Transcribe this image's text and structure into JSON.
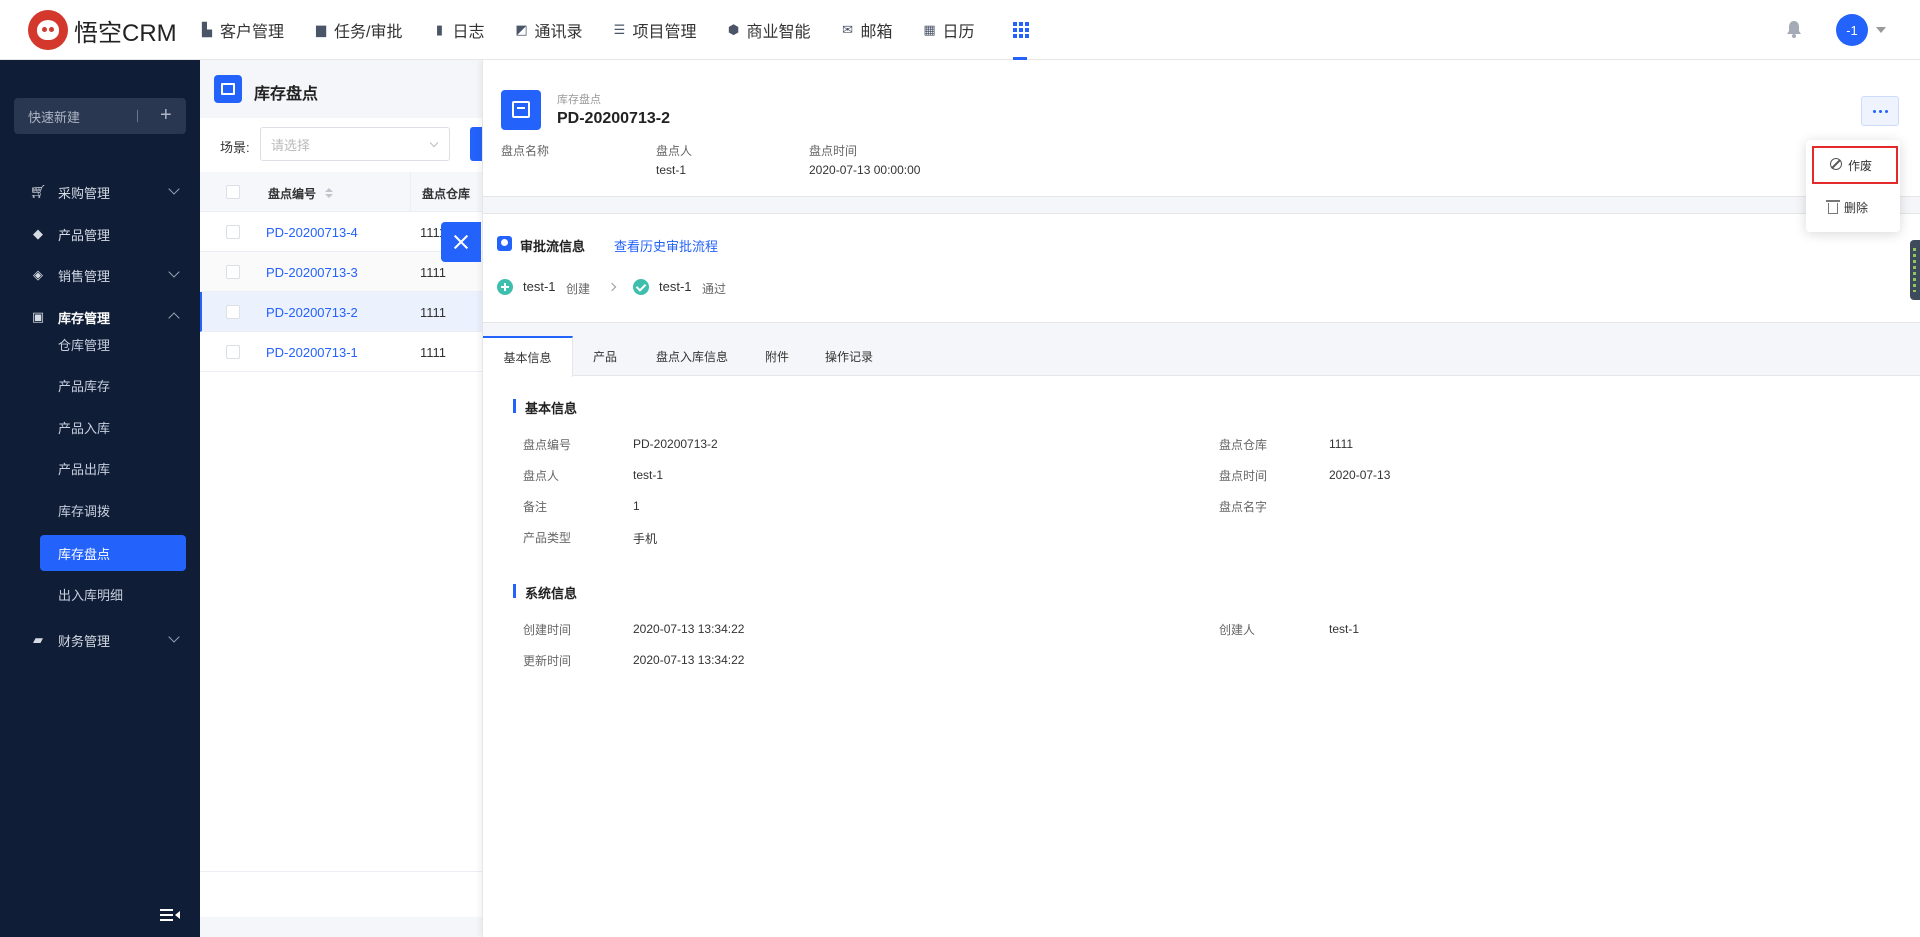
{
  "app": {
    "logo_text": "悟空CRM"
  },
  "nav": {
    "items": [
      {
        "label": "客户管理",
        "icon": "building-icon"
      },
      {
        "label": "任务/审批",
        "icon": "briefcase-icon"
      },
      {
        "label": "日志",
        "icon": "journal-icon"
      },
      {
        "label": "通讯录",
        "icon": "phone-book-icon"
      },
      {
        "label": "项目管理",
        "icon": "project-icon"
      },
      {
        "label": "商业智能",
        "icon": "bi-icon"
      },
      {
        "label": "邮箱",
        "icon": "mail-icon"
      },
      {
        "label": "日历",
        "icon": "calendar-icon"
      }
    ],
    "apps_icon": "grid-icon",
    "avatar_text": "-1"
  },
  "sidebar": {
    "quick_create": "快速新建",
    "menus": [
      {
        "label": "采购管理",
        "icon": "cart-icon"
      },
      {
        "label": "产品管理",
        "icon": "cube-icon"
      },
      {
        "label": "销售管理",
        "icon": "tag-icon"
      },
      {
        "label": "库存管理",
        "icon": "inventory-icon"
      },
      {
        "label": "财务管理",
        "icon": "wallet-icon"
      }
    ],
    "inventory_sub": [
      "仓库管理",
      "产品库存",
      "产品入库",
      "产品出库",
      "库存调拨",
      "库存盘点",
      "出入库明细"
    ]
  },
  "list": {
    "page_title": "库存盘点",
    "scene_label": "场景:",
    "scene_placeholder": "请选择",
    "columns": [
      "盘点编号",
      "盘点仓库"
    ],
    "rows": [
      {
        "code": "PD-20200713-4",
        "warehouse": "1111"
      },
      {
        "code": "PD-20200713-3",
        "warehouse": "1111"
      },
      {
        "code": "PD-20200713-2",
        "warehouse": "1111"
      },
      {
        "code": "PD-20200713-1",
        "warehouse": "1111"
      }
    ]
  },
  "detail": {
    "type_label": "库存盘点",
    "name": "PD-20200713-2",
    "header_fields": [
      {
        "label": "盘点名称",
        "value": ""
      },
      {
        "label": "盘点人",
        "value": "test-1"
      },
      {
        "label": "盘点时间",
        "value": "2020-07-13 00:00:00"
      }
    ],
    "approval": {
      "title": "审批流信息",
      "history_link": "查看历史审批流程",
      "steps": [
        {
          "user": "test-1",
          "action": "创建"
        },
        {
          "user": "test-1",
          "action": "通过"
        }
      ]
    },
    "tabs": [
      "基本信息",
      "产品",
      "盘点入库信息",
      "附件",
      "操作记录"
    ],
    "basic": {
      "title": "基本信息",
      "left": [
        {
          "label": "盘点编号",
          "value": "PD-20200713-2"
        },
        {
          "label": "盘点人",
          "value": "test-1"
        },
        {
          "label": "备注",
          "value": "1"
        },
        {
          "label": "产品类型",
          "value": "手机"
        }
      ],
      "right": [
        {
          "label": "盘点仓库",
          "value": "1111"
        },
        {
          "label": "盘点时间",
          "value": "2020-07-13"
        },
        {
          "label": "盘点名字",
          "value": ""
        }
      ]
    },
    "system": {
      "title": "系统信息",
      "left": [
        {
          "label": "创建时间",
          "value": "2020-07-13 13:34:22"
        },
        {
          "label": "更新时间",
          "value": "2020-07-13 13:34:22"
        }
      ],
      "right": [
        {
          "label": "创建人",
          "value": "test-1"
        }
      ]
    },
    "more_menu": [
      "作废",
      "删除"
    ]
  },
  "colors": {
    "accent": "#2362fb",
    "sidebar_bg": "#0f1d37",
    "highlight_border": "#e22a2a",
    "approval_green": "#3ebfae"
  }
}
